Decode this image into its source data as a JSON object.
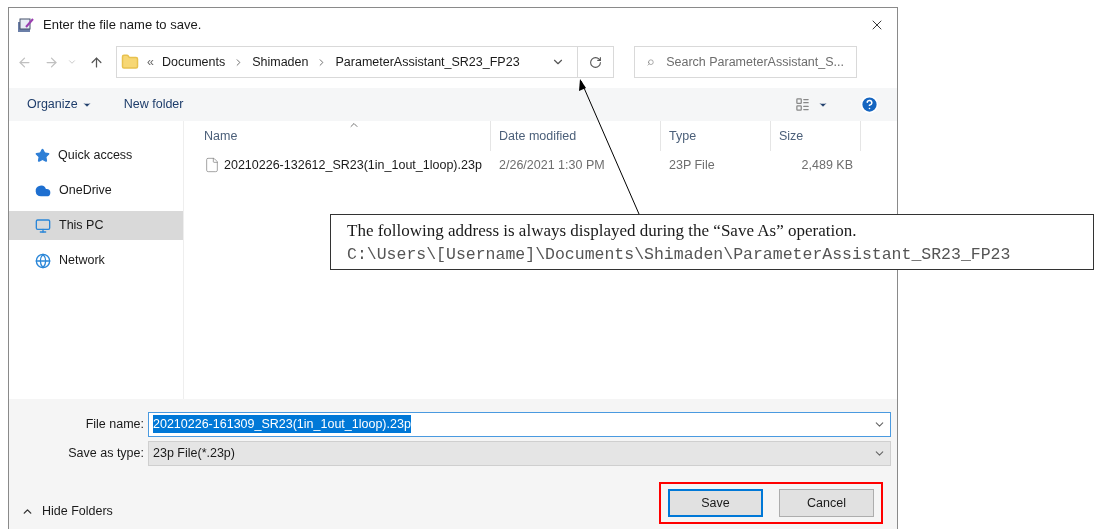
{
  "window": {
    "title": "Enter the file name to save."
  },
  "address": {
    "overflow": "«",
    "segments": [
      "Documents",
      "Shimaden",
      "ParameterAssistant_SR23_FP23"
    ]
  },
  "search": {
    "placeholder": "Search ParameterAssistant_S..."
  },
  "toolbar": {
    "organize": "Organize",
    "new_folder": "New folder"
  },
  "sidebar": {
    "items": [
      {
        "label": "Quick access",
        "kind": "star",
        "selected": false
      },
      {
        "label": "OneDrive",
        "kind": "cloud",
        "selected": false
      },
      {
        "label": "This PC",
        "kind": "pc",
        "selected": true
      },
      {
        "label": "Network",
        "kind": "network",
        "selected": false
      }
    ]
  },
  "table": {
    "columns": [
      "Name",
      "Date modified",
      "Type",
      "Size"
    ],
    "rows": [
      [
        "20210226-132612_SR23(1in_1out_1loop).23p",
        "2/26/2021 1:30 PM",
        "23P File",
        "2,489 KB"
      ]
    ]
  },
  "file_name": {
    "label": "File name:",
    "value": "20210226-161309_SR23(1in_1out_1loop).23p",
    "selected": true
  },
  "save_type": {
    "label": "Save as type:",
    "value": "23p File(*.23p)"
  },
  "hide_folders": "Hide Folders",
  "buttons": [
    {
      "label": "Save",
      "default": true
    },
    {
      "label": "Cancel",
      "default": false
    }
  ],
  "annotation": {
    "text": "The following address is always displayed during the “Save As” operation.",
    "path": "C:\\Users\\[Username]\\Documents\\Shimaden\\ParameterAssistant_SR23_FP23"
  }
}
